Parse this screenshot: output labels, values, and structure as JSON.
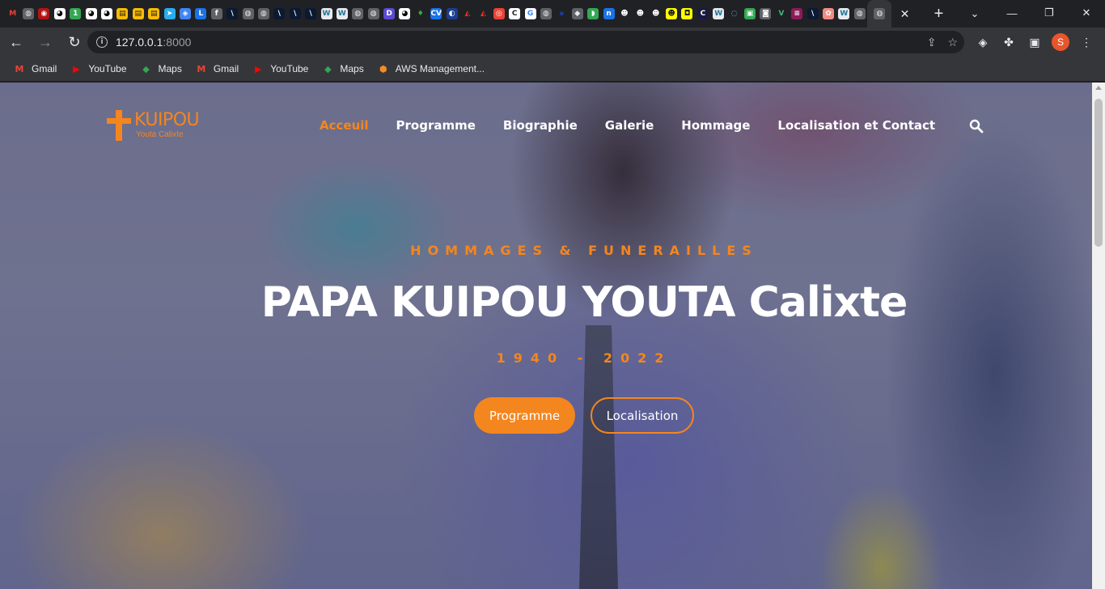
{
  "browser": {
    "tabs": [
      {
        "icon": "gmail-icon",
        "glyph": "M",
        "bg": "#202124",
        "fg": "#ea4335"
      },
      {
        "icon": "globe-icon",
        "glyph": "◍",
        "bg": "#5f6368",
        "fg": "#e8eaed"
      },
      {
        "icon": "app-icon",
        "glyph": "◉",
        "bg": "#b31412",
        "fg": "#ffffff"
      },
      {
        "icon": "github-icon",
        "glyph": "◕",
        "bg": "#ffffff",
        "fg": "#000000"
      },
      {
        "icon": "app-1-icon",
        "glyph": "1",
        "bg": "#34a853",
        "fg": "#ffffff"
      },
      {
        "icon": "github-icon",
        "glyph": "◕",
        "bg": "#ffffff",
        "fg": "#000000"
      },
      {
        "icon": "github-icon",
        "glyph": "◕",
        "bg": "#ffffff",
        "fg": "#000000"
      },
      {
        "icon": "store-icon",
        "glyph": "▤",
        "bg": "#fbbc04",
        "fg": "#202124"
      },
      {
        "icon": "store-icon",
        "glyph": "▤",
        "bg": "#fbbc04",
        "fg": "#202124"
      },
      {
        "icon": "store-icon",
        "glyph": "▤",
        "bg": "#fbbc04",
        "fg": "#202124"
      },
      {
        "icon": "telegram-icon",
        "glyph": "➤",
        "bg": "#2aabee",
        "fg": "#ffffff"
      },
      {
        "icon": "cube-icon",
        "glyph": "◈",
        "bg": "#4285f4",
        "fg": "#ffffff"
      },
      {
        "icon": "app-l-icon",
        "glyph": "L",
        "bg": "#1a73e8",
        "fg": "#ffffff"
      },
      {
        "icon": "facebook-icon",
        "glyph": "f",
        "bg": "#5f6368",
        "fg": "#ffffff"
      },
      {
        "icon": "slash-icon",
        "glyph": "\\",
        "bg": "#0b1a33",
        "fg": "#ffffff"
      },
      {
        "icon": "globe-icon",
        "glyph": "◍",
        "bg": "#5f6368",
        "fg": "#e8eaed"
      },
      {
        "icon": "globe-icon",
        "glyph": "◍",
        "bg": "#5f6368",
        "fg": "#e8eaed"
      },
      {
        "icon": "slash-icon",
        "glyph": "\\",
        "bg": "#0b1a33",
        "fg": "#ffffff"
      },
      {
        "icon": "slash-icon",
        "glyph": "\\",
        "bg": "#0b1a33",
        "fg": "#ffffff"
      },
      {
        "icon": "slash-icon",
        "glyph": "\\",
        "bg": "#0b1a33",
        "fg": "#ffffff"
      },
      {
        "icon": "wordpress-icon",
        "glyph": "W",
        "bg": "#e8eaed",
        "fg": "#21759b"
      },
      {
        "icon": "wordpress-icon",
        "glyph": "W",
        "bg": "#e8eaed",
        "fg": "#21759b"
      },
      {
        "icon": "globe-icon",
        "glyph": "◍",
        "bg": "#5f6368",
        "fg": "#e8eaed"
      },
      {
        "icon": "globe-icon",
        "glyph": "◍",
        "bg": "#5f6368",
        "fg": "#e8eaed"
      },
      {
        "icon": "app-d-icon",
        "glyph": "D",
        "bg": "#5b4bd5",
        "fg": "#ffffff"
      },
      {
        "icon": "github-icon",
        "glyph": "◕",
        "bg": "#ffffff",
        "fg": "#000000"
      },
      {
        "icon": "leaf-icon",
        "glyph": "♦",
        "bg": "#202124",
        "fg": "#34a853"
      },
      {
        "icon": "cv-icon",
        "glyph": "CV",
        "bg": "#1a73e8",
        "fg": "#ffffff"
      },
      {
        "icon": "app-icon",
        "glyph": "◐",
        "bg": "#1a3d8f",
        "fg": "#ffffff"
      },
      {
        "icon": "laravel-icon",
        "glyph": "◭",
        "bg": "#202124",
        "fg": "#ff2d20"
      },
      {
        "icon": "laravel-icon",
        "glyph": "◭",
        "bg": "#202124",
        "fg": "#ff2d20"
      },
      {
        "icon": "app-icon",
        "glyph": "◎",
        "bg": "#ea4335",
        "fg": "#ffffff"
      },
      {
        "icon": "app-c-icon",
        "glyph": "C",
        "bg": "#ffffff",
        "fg": "#202124"
      },
      {
        "icon": "google-icon",
        "glyph": "G",
        "bg": "#ffffff",
        "fg": "#4285f4"
      },
      {
        "icon": "globe-icon",
        "glyph": "◍",
        "bg": "#5f6368",
        "fg": "#e8eaed"
      },
      {
        "icon": "app-icon",
        "glyph": "▪",
        "bg": "#202124",
        "fg": "#1a3d8f"
      },
      {
        "icon": "box-icon",
        "glyph": "◆",
        "bg": "#5f6368",
        "fg": "#e8eaed"
      },
      {
        "icon": "app-icon",
        "glyph": "◗",
        "bg": "#34a853",
        "fg": "#ffffff"
      },
      {
        "icon": "app-n-icon",
        "glyph": "n",
        "bg": "#1a73e8",
        "fg": "#ffffff"
      },
      {
        "icon": "snapchat-icon",
        "glyph": "☻",
        "bg": "#202124",
        "fg": "#ffffff"
      },
      {
        "icon": "snapchat-icon",
        "glyph": "☻",
        "bg": "#202124",
        "fg": "#ffffff"
      },
      {
        "icon": "snapchat-icon",
        "glyph": "☻",
        "bg": "#202124",
        "fg": "#ffffff"
      },
      {
        "icon": "snapchat-icon",
        "glyph": "☻",
        "bg": "#fffc00",
        "fg": "#202124"
      },
      {
        "icon": "app-icon",
        "glyph": "◘",
        "bg": "#fffc00",
        "fg": "#202124"
      },
      {
        "icon": "app-c-icon",
        "glyph": "C",
        "bg": "#1a1a40",
        "fg": "#ffffff"
      },
      {
        "icon": "wordpress-icon",
        "glyph": "W",
        "bg": "#e8eaed",
        "fg": "#21759b"
      },
      {
        "icon": "app-icon",
        "glyph": "◌",
        "bg": "#202124",
        "fg": "#8ab4f8"
      },
      {
        "icon": "app-icon",
        "glyph": "▣",
        "bg": "#34a853",
        "fg": "#ffffff"
      },
      {
        "icon": "app-icon",
        "glyph": "◙",
        "bg": "#5f6368",
        "fg": "#ffffff"
      },
      {
        "icon": "vue-icon",
        "glyph": "V",
        "bg": "#202124",
        "fg": "#41b883"
      },
      {
        "icon": "app-icon",
        "glyph": "≡",
        "bg": "#8e1a5b",
        "fg": "#ffffff"
      },
      {
        "icon": "slash-icon",
        "glyph": "\\",
        "bg": "#0b1a33",
        "fg": "#ffffff"
      },
      {
        "icon": "app-icon",
        "glyph": "✿",
        "bg": "#f28b82",
        "fg": "#ffffff"
      },
      {
        "icon": "wordpress-icon",
        "glyph": "W",
        "bg": "#e8eaed",
        "fg": "#21759b"
      },
      {
        "icon": "globe-icon",
        "glyph": "◍",
        "bg": "#5f6368",
        "fg": "#e8eaed"
      }
    ],
    "active_tab": {
      "icon": "globe-icon",
      "glyph": "◍"
    },
    "close_glyph": "✕",
    "newtab_glyph": "+",
    "tabsearch_glyph": "⌄",
    "window_controls": {
      "minimize": "—",
      "restore": "❐",
      "close": "✕"
    },
    "nav": {
      "back": "←",
      "forward": "→",
      "reload": "↻"
    },
    "info_glyph": "i",
    "url_host": "127.0.0.1",
    "url_port": ":8000",
    "share_glyph": "⇪",
    "star_glyph": "☆",
    "ext_glyphs": {
      "ext1": "◈",
      "puzzle": "✤",
      "sidepanel": "▣"
    },
    "profile_initial": "S",
    "bookmarks": [
      {
        "label": "Gmail",
        "icon": "gmail-icon",
        "glyph": "M",
        "color": "#ea4335"
      },
      {
        "label": "YouTube",
        "icon": "youtube-icon",
        "glyph": "▶",
        "color": "#ff0000"
      },
      {
        "label": "Maps",
        "icon": "maps-icon",
        "glyph": "◆",
        "color": "#34a853"
      },
      {
        "label": "Gmail",
        "icon": "gmail-icon",
        "glyph": "M",
        "color": "#ea4335"
      },
      {
        "label": "YouTube",
        "icon": "youtube-icon",
        "glyph": "▶",
        "color": "#ff0000"
      },
      {
        "label": "Maps",
        "icon": "maps-icon",
        "glyph": "◆",
        "color": "#34a853"
      },
      {
        "label": "AWS Management...",
        "icon": "aws-icon",
        "glyph": "⬢",
        "color": "#f48c23"
      }
    ]
  },
  "site": {
    "logo_name": "KUIPOU",
    "logo_sub": "Youta Calixte",
    "nav": [
      "Acceuil",
      "Programme",
      "Biographie",
      "Galerie",
      "Hommage",
      "Localisation et Contact"
    ],
    "hero_eyebrow": "HOMMAGES & FUNERAILLES",
    "hero_title": "PAPA KUIPOU YOUTA Calixte",
    "hero_dates": "1940 - 2022",
    "btn_primary": "Programme",
    "btn_secondary": "Localisation",
    "accent_color": "#f4861f"
  }
}
